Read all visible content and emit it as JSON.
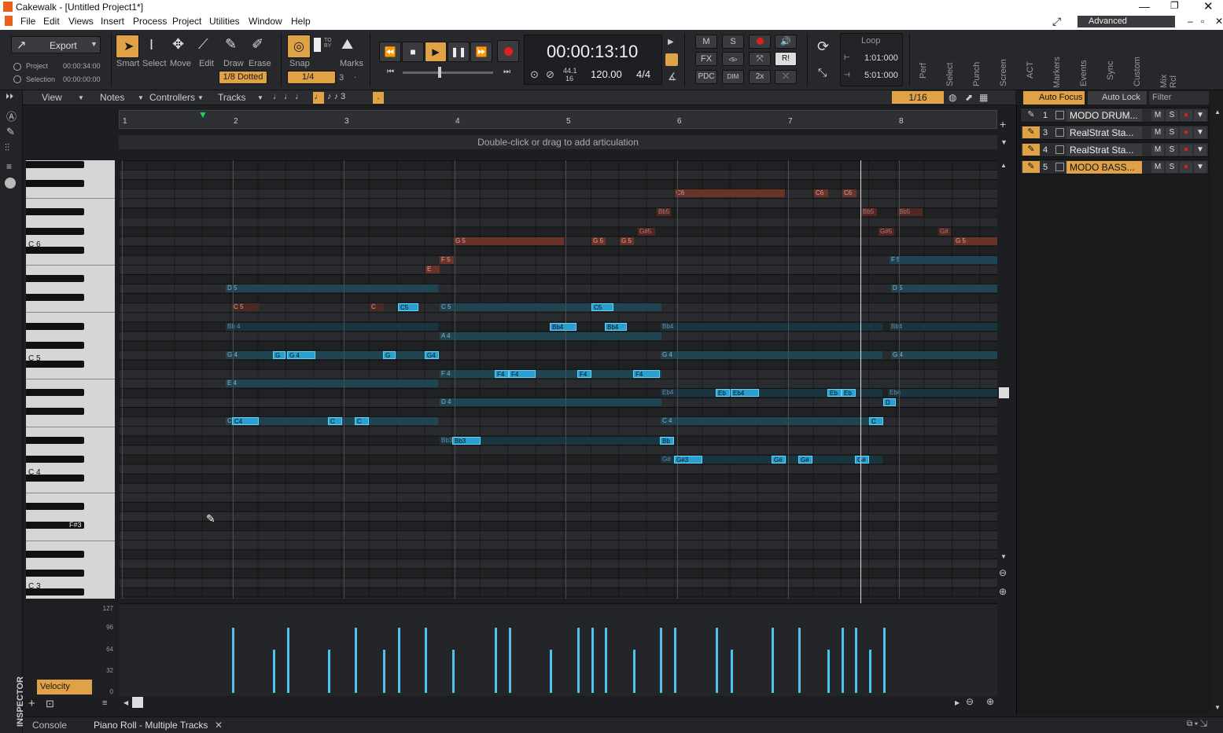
{
  "window": {
    "title": "Cakewalk - [Untitled Project1*]"
  },
  "menu": [
    "File",
    "Edit",
    "Views",
    "Insert",
    "Process",
    "Project",
    "Utilities",
    "Window",
    "Help"
  ],
  "workspace": "Advanced",
  "toolbar": {
    "export_label": "Export",
    "project_label": "Project",
    "project_time": "00:00:34:00",
    "selection_label": "Selection",
    "selection_time": "00:00:00:00",
    "tools": [
      "Smart",
      "Select",
      "Move",
      "Edit",
      "Draw",
      "Erase"
    ],
    "draw_duration": "1/8 Dotted",
    "snap_label": "Snap",
    "snap_value": "1/4",
    "snap_extra": "3",
    "marks_label": "Marks",
    "time": "00:00:13:10",
    "sample_rate": "44.1",
    "bit_depth": "16",
    "tempo": "120.00",
    "meter": "4/4",
    "mix_buttons": [
      "M",
      "S",
      "FX",
      "PDC",
      "DIM",
      "2x"
    ],
    "loop_label": "Loop",
    "loop_start": "1:01:000",
    "loop_end": "5:01:000",
    "modules": [
      "Perf",
      "Select",
      "Punch",
      "Screen",
      "ACT",
      "Markers",
      "Events",
      "Sync",
      "Custom",
      "Mix Rcl"
    ]
  },
  "pianoroll": {
    "menus": [
      "View",
      "Notes",
      "Controllers",
      "Tracks"
    ],
    "snap_value": "1/16",
    "auto_focus": "Auto Focus",
    "auto_lock": "Auto Lock",
    "filter": "Filter",
    "articulation_hint": "Double-click or drag to add articulation",
    "ruler": [
      "1",
      "2",
      "3",
      "4",
      "5",
      "6",
      "7",
      "8"
    ],
    "key_labels": {
      "c6": "C 6",
      "c5": "C 5",
      "c4": "C 4",
      "f3": "F#3",
      "c3": "C 3"
    },
    "velocity_axis": [
      "127",
      "96",
      "64",
      "32",
      "0"
    ],
    "velocity_label": "Velocity",
    "notes_blue": [
      {
        "t": "C5",
        "p": "C5"
      },
      {
        "t": "G",
        "p": "G4"
      },
      {
        "t": "G 4",
        "p": "G4"
      },
      {
        "t": "G",
        "p": "G4"
      },
      {
        "t": "G4",
        "p": "G4"
      },
      {
        "t": "C4",
        "p": "C4"
      },
      {
        "t": "C",
        "p": "C4"
      },
      {
        "t": "C",
        "p": "C4"
      },
      {
        "t": "Bb4",
        "p": "Bb4"
      },
      {
        "t": "Bb4",
        "p": "Bb4"
      },
      {
        "t": "C5",
        "p": "C5"
      },
      {
        "t": "F4",
        "p": "F4"
      },
      {
        "t": "F4",
        "p": "F4"
      },
      {
        "t": "F4",
        "p": "F4"
      },
      {
        "t": "F4",
        "p": "F4"
      },
      {
        "t": "Bb3",
        "p": "Bb3"
      },
      {
        "t": "Bb",
        "p": "Bb3"
      },
      {
        "t": "G#3",
        "p": "G#3"
      },
      {
        "t": "G#",
        "p": "G#3"
      },
      {
        "t": "G#",
        "p": "G#3"
      },
      {
        "t": "G#",
        "p": "G#3"
      },
      {
        "t": "Eb",
        "p": "Eb4"
      },
      {
        "t": "Eb4",
        "p": "Eb4"
      },
      {
        "t": "Eb",
        "p": "Eb4"
      },
      {
        "t": "Eb",
        "p": "Eb4"
      },
      {
        "t": "D",
        "p": "D4"
      },
      {
        "t": "C",
        "p": "C4"
      }
    ],
    "velocities": [
      96,
      64,
      96,
      64,
      96,
      64,
      96,
      96,
      64,
      96,
      96,
      64,
      96,
      96,
      96,
      64,
      96,
      96,
      96,
      64,
      96,
      96,
      64,
      96,
      96,
      64,
      96
    ]
  },
  "tracks": [
    {
      "num": "1",
      "name": "MODO DRUM..."
    },
    {
      "num": "3",
      "name": "RealStrat Sta..."
    },
    {
      "num": "4",
      "name": "RealStrat Sta..."
    },
    {
      "num": "5",
      "name": "MODO BASS..."
    }
  ],
  "bottom_tabs": {
    "console": "Console",
    "pianoroll": "Piano Roll - Multiple Tracks"
  },
  "inspector": "INSPECTOR"
}
